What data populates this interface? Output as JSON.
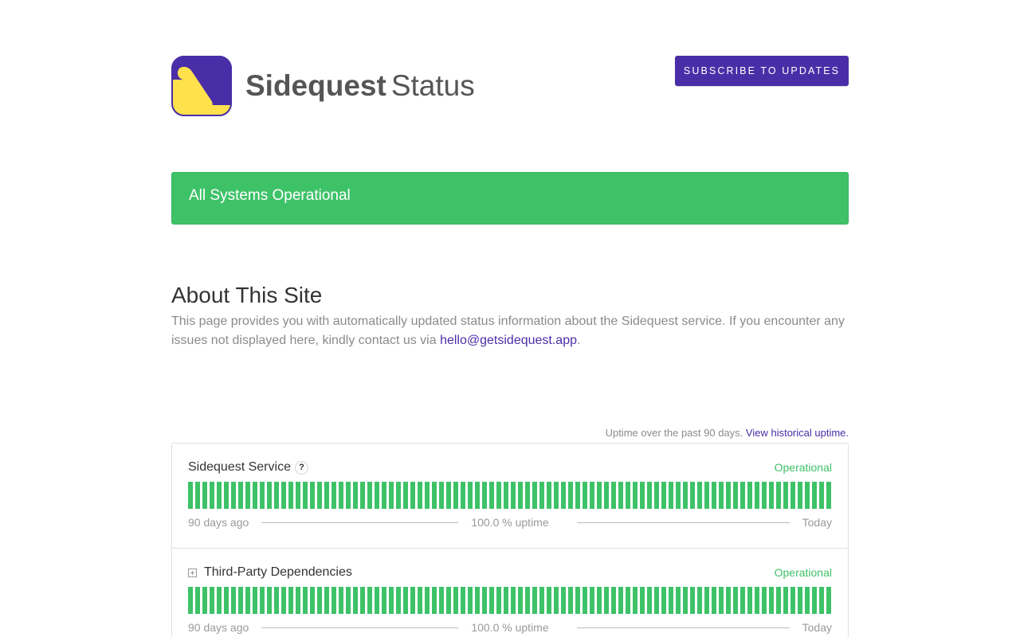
{
  "header": {
    "brand_name": "Sidequest",
    "brand_suffix": "Status",
    "subscribe_label": "SUBSCRIBE TO UPDATES",
    "logo_icon": "sidequest-logo-icon",
    "colors": {
      "accent": "#4a2ea7",
      "logo_yellow": "#ffe14d"
    }
  },
  "status_banner": {
    "text": "All Systems Operational",
    "color": "#3ec268"
  },
  "about": {
    "title": "About This Site",
    "body_before_link": "This page provides you with automatically updated status information about the Sidequest service. If you encounter any issues not displayed here, kindly contact us via ",
    "email": "hello@getsidequest.app",
    "body_after_link": "."
  },
  "uptime_caption": {
    "text": "Uptime over the past 90 days.",
    "link": "View historical uptime."
  },
  "components": [
    {
      "name": "Sidequest Service",
      "help_icon": "?",
      "status": "Operational",
      "days": 90,
      "legend_left": "90 days ago",
      "legend_mid": "100.0 % uptime",
      "legend_right": "Today"
    },
    {
      "name": "Third-Party Dependencies",
      "status": "Operational",
      "days": 90,
      "legend_left": "90 days ago",
      "legend_mid": "100.0 % uptime",
      "legend_right": "Today"
    }
  ]
}
